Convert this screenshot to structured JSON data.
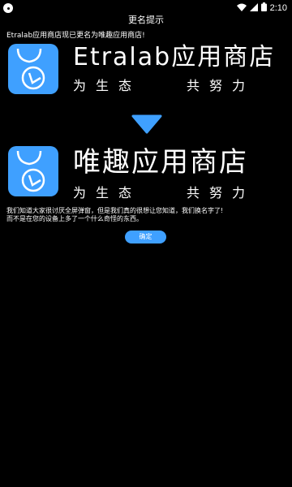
{
  "status_bar": {
    "time": "2:10",
    "icons": [
      "app-notification-icon",
      "wifi-icon",
      "cellular-signal-icon",
      "battery-icon"
    ]
  },
  "dialog": {
    "title": "更名提示",
    "notice": "Etralab应用商店现已更名为唯趣应用商店!",
    "old_brand": {
      "name": "Etralab应用商店",
      "slogan_left": "为生态",
      "slogan_right": "共努力"
    },
    "arrow_icon": "arrow-down-icon",
    "new_brand": {
      "name": "唯趣应用商店",
      "slogan_left": "为生态",
      "slogan_right": "共努力"
    },
    "description_line1": "我们知道大家很讨厌全屏弹窗，但是我们真的很想让您知道，我们换名字了!",
    "description_line2": "而不是在您的设备上多了一个什么奇怪的东西。",
    "ok_label": "确定"
  },
  "colors": {
    "accent": "#3fa0ff",
    "background": "#000000",
    "text": "#ffffff"
  }
}
